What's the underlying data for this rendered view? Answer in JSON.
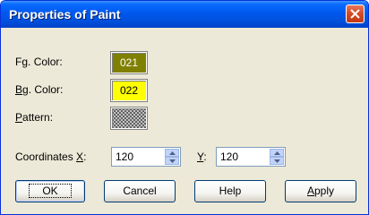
{
  "window": {
    "title": "Properties of Paint"
  },
  "fields": {
    "fg": {
      "label_pre": "F",
      "label_u": "g",
      "label_post": ". Color:",
      "value": "021",
      "color": "#808000"
    },
    "bg": {
      "label_pre": "",
      "label_u": "B",
      "label_post": "g. Color:",
      "value": "022",
      "color": "#ffff00"
    },
    "pattern": {
      "label_pre": "",
      "label_u": "P",
      "label_post": "attern:"
    }
  },
  "coordinates": {
    "label_pre": "Coordinates ",
    "x_u": "X",
    "x_post": ":",
    "x_value": "120",
    "y_u": "Y",
    "y_post": ":",
    "y_value": "120"
  },
  "buttons": {
    "ok": "OK",
    "cancel": "Cancel",
    "help": "Help",
    "apply_u": "A",
    "apply_post": "pply"
  },
  "icons": {
    "close": "close-icon",
    "spin_up": "arrow-up-icon",
    "spin_down": "arrow-down-icon"
  },
  "colors": {
    "title_bar": "#0058ee",
    "dialog_bg": "#ece9d8",
    "close_button": "#d44a22"
  }
}
